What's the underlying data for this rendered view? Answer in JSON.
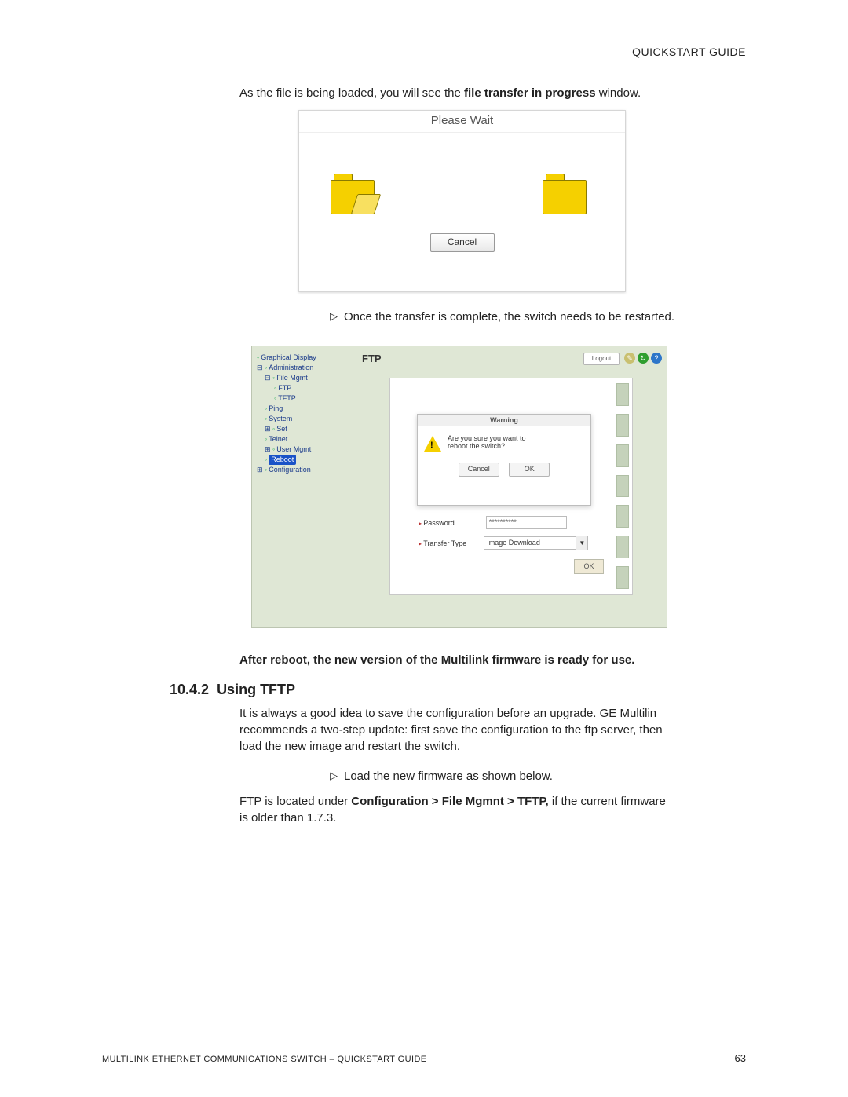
{
  "header": {
    "title": "QUICKSTART GUIDE"
  },
  "intro": {
    "pre": "As the file is being loaded, you will see the ",
    "bold": "file transfer in progress",
    "post": " window."
  },
  "please_wait": {
    "title": "Please Wait",
    "cancel": "Cancel"
  },
  "step1": "Once the transfer is complete, the switch needs to be restarted.",
  "ftp": {
    "heading": "FTP",
    "logout": "Logout",
    "tree": {
      "graphical": "Graphical Display",
      "admin": "Administration",
      "filemgmt": "File Mgmt",
      "ftp": "FTP",
      "tftp": "TFTP",
      "ping": "Ping",
      "system": "System",
      "set": "Set",
      "telnet": "Telnet",
      "usermgmt": "User Mgmt",
      "reboot": "Reboot",
      "configuration": "Configuration"
    },
    "warning": {
      "title": "Warning",
      "msg1": "Are you sure you want to",
      "msg2": "reboot the switch?",
      "cancel": "Cancel",
      "ok": "OK"
    },
    "fields": {
      "password_label": "Password",
      "password_value": "**********",
      "transfer_label": "Transfer Type",
      "transfer_value": "Image Download"
    },
    "ok_button": "OK"
  },
  "after_reboot": "After reboot, the new version of the Multilink firmware is ready for use",
  "section": {
    "number": "10.4.2",
    "title": "Using TFTP"
  },
  "para1": "It is always a good idea to save the configuration before an upgrade. GE Multilin recommends a two-step update: first save the configuration to the ftp server, then load the new image and restart the switch.",
  "step2": "Load the new firmware as shown below.",
  "para2": {
    "pre": "FTP is located under ",
    "bold": "Configuration > File Mgmnt > TFTP,",
    "post": " if the current firmware is older than 1.7.3."
  },
  "footer": {
    "left": "MULTILINK ETHERNET COMMUNICATIONS SWITCH – QUICKSTART GUIDE",
    "page": "63"
  }
}
